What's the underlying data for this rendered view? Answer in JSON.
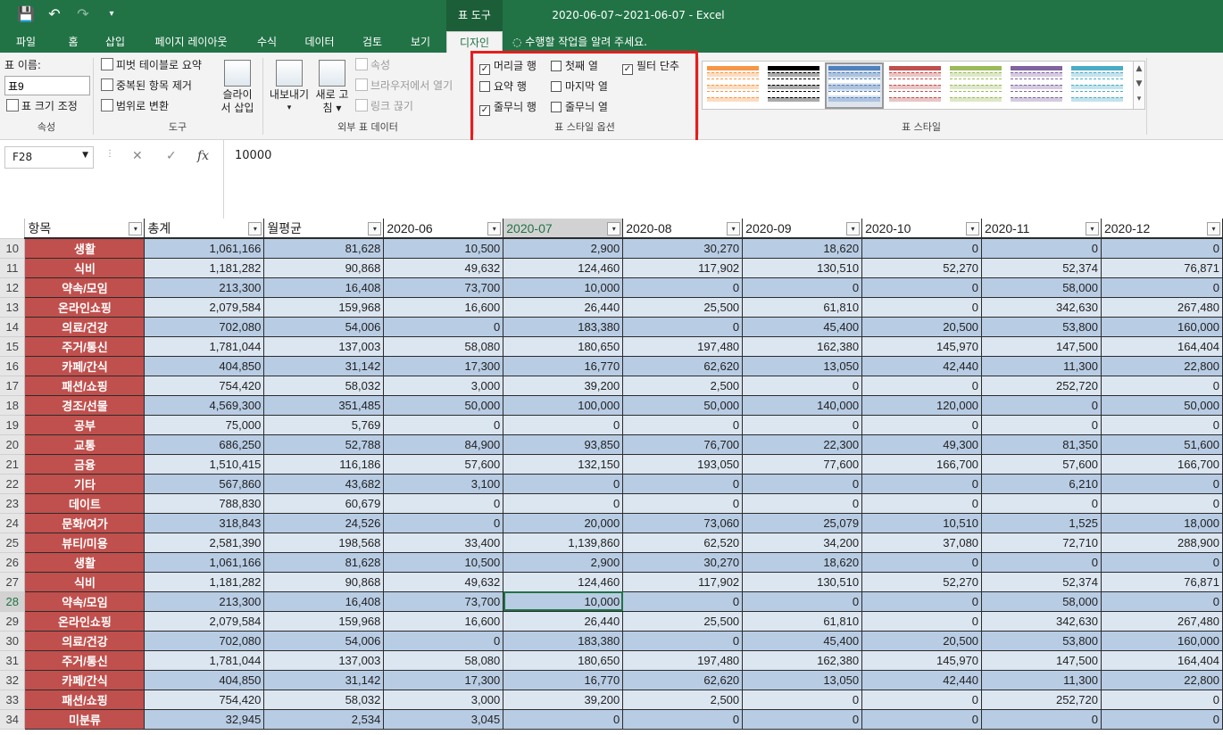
{
  "window": {
    "title": "2020-06-07~2021-06-07 - Excel",
    "context_label": "표 도구"
  },
  "qat": {
    "save": "💾",
    "undo": "↶",
    "redo": "↷",
    "more": "▾"
  },
  "tabs": [
    {
      "label": "파일"
    },
    {
      "label": "홈"
    },
    {
      "label": "삽입"
    },
    {
      "label": "페이지 레이아웃"
    },
    {
      "label": "수식"
    },
    {
      "label": "데이터"
    },
    {
      "label": "검토"
    },
    {
      "label": "보기"
    },
    {
      "label": "디자인"
    }
  ],
  "tell_me": "수행할 작업을 알려 주세요.",
  "ribbon": {
    "props": {
      "name_label": "표 이름:",
      "name_value": "표9",
      "resize": "표 크기 조정",
      "group": "속성"
    },
    "tools": {
      "pivot": "피벗 테이블로 요약",
      "dedupe": "중복된 항목 제거",
      "convert": "범위로 변환",
      "slicer_1": "슬라이",
      "slicer_2": "서 삽입",
      "group": "도구"
    },
    "external": {
      "export_1": "내보내기",
      "export_arrow": "▾",
      "refresh_1": "새로 고",
      "refresh_2": "침 ▾",
      "props": "속성",
      "open_browser": "브라우저에서 열기",
      "unlink": "링크 끊기",
      "group": "외부 표 데이터"
    },
    "options": {
      "header_row": "머리글 행",
      "first_col": "첫째 열",
      "filter_btn": "필터 단추",
      "total_row": "요약 행",
      "last_col": "마지막 열",
      "banded_rows": "줄무늬 행",
      "banded_cols": "줄무늬 열",
      "group": "표 스타일 옵션",
      "checks": {
        "header_row": true,
        "first_col": false,
        "filter_btn": true,
        "total_row": false,
        "last_col": false,
        "banded_rows": true,
        "banded_cols": false
      }
    },
    "styles": {
      "group": "표 스타일",
      "colors": [
        "#f79646",
        "#000000",
        "#4f81bd",
        "#c0504d",
        "#9bbb59",
        "#8064a2",
        "#4bacc6"
      ]
    }
  },
  "formula": {
    "cell": "F28",
    "value": "10000",
    "cancel": "✕",
    "enter": "✓",
    "fx": "fx"
  },
  "sheet": {
    "headers": [
      "항목",
      "총계",
      "월평균",
      "2020-06",
      "2020-07",
      "2020-08",
      "2020-09",
      "2020-10",
      "2020-11",
      "2020-12"
    ],
    "rows": [
      {
        "n": "10",
        "c": [
          "생활",
          "1,061,166",
          "81,628",
          "10,500",
          "2,900",
          "30,270",
          "18,620",
          "0",
          "0",
          "0"
        ]
      },
      {
        "n": "11",
        "c": [
          "식비",
          "1,181,282",
          "90,868",
          "49,632",
          "124,460",
          "117,902",
          "130,510",
          "52,270",
          "52,374",
          "76,871"
        ]
      },
      {
        "n": "12",
        "c": [
          "약속/모임",
          "213,300",
          "16,408",
          "73,700",
          "10,000",
          "0",
          "0",
          "0",
          "58,000",
          "0"
        ]
      },
      {
        "n": "13",
        "c": [
          "온라인쇼핑",
          "2,079,584",
          "159,968",
          "16,600",
          "26,440",
          "25,500",
          "61,810",
          "0",
          "342,630",
          "267,480"
        ]
      },
      {
        "n": "14",
        "c": [
          "의료/건강",
          "702,080",
          "54,006",
          "0",
          "183,380",
          "0",
          "45,400",
          "20,500",
          "53,800",
          "160,000"
        ]
      },
      {
        "n": "15",
        "c": [
          "주거/통신",
          "1,781,044",
          "137,003",
          "58,080",
          "180,650",
          "197,480",
          "162,380",
          "145,970",
          "147,500",
          "164,404"
        ]
      },
      {
        "n": "16",
        "c": [
          "카페/간식",
          "404,850",
          "31,142",
          "17,300",
          "16,770",
          "62,620",
          "13,050",
          "42,440",
          "11,300",
          "22,800"
        ]
      },
      {
        "n": "17",
        "c": [
          "패션/쇼핑",
          "754,420",
          "58,032",
          "3,000",
          "39,200",
          "2,500",
          "0",
          "0",
          "252,720",
          "0"
        ]
      },
      {
        "n": "18",
        "c": [
          "경조/선물",
          "4,569,300",
          "351,485",
          "50,000",
          "100,000",
          "50,000",
          "140,000",
          "120,000",
          "0",
          "50,000"
        ]
      },
      {
        "n": "19",
        "c": [
          "공부",
          "75,000",
          "5,769",
          "0",
          "0",
          "0",
          "0",
          "0",
          "0",
          "0"
        ]
      },
      {
        "n": "20",
        "c": [
          "교통",
          "686,250",
          "52,788",
          "84,900",
          "93,850",
          "76,700",
          "22,300",
          "49,300",
          "81,350",
          "51,600"
        ]
      },
      {
        "n": "21",
        "c": [
          "금융",
          "1,510,415",
          "116,186",
          "57,600",
          "132,150",
          "193,050",
          "77,600",
          "166,700",
          "57,600",
          "166,700"
        ]
      },
      {
        "n": "22",
        "c": [
          "기타",
          "567,860",
          "43,682",
          "3,100",
          "0",
          "0",
          "0",
          "0",
          "6,210",
          "0"
        ]
      },
      {
        "n": "23",
        "c": [
          "데이트",
          "788,830",
          "60,679",
          "0",
          "0",
          "0",
          "0",
          "0",
          "0",
          "0"
        ]
      },
      {
        "n": "24",
        "c": [
          "문화/여가",
          "318,843",
          "24,526",
          "0",
          "20,000",
          "73,060",
          "25,079",
          "10,510",
          "1,525",
          "18,000"
        ]
      },
      {
        "n": "25",
        "c": [
          "뷰티/미용",
          "2,581,390",
          "198,568",
          "33,400",
          "1,139,860",
          "62,520",
          "34,200",
          "37,080",
          "72,710",
          "288,900"
        ]
      },
      {
        "n": "26",
        "c": [
          "생활",
          "1,061,166",
          "81,628",
          "10,500",
          "2,900",
          "30,270",
          "18,620",
          "0",
          "0",
          "0"
        ]
      },
      {
        "n": "27",
        "c": [
          "식비",
          "1,181,282",
          "90,868",
          "49,632",
          "124,460",
          "117,902",
          "130,510",
          "52,270",
          "52,374",
          "76,871"
        ]
      },
      {
        "n": "28",
        "c": [
          "약속/모임",
          "213,300",
          "16,408",
          "73,700",
          "10,000",
          "0",
          "0",
          "0",
          "58,000",
          "0"
        ]
      },
      {
        "n": "29",
        "c": [
          "온라인쇼핑",
          "2,079,584",
          "159,968",
          "16,600",
          "26,440",
          "25,500",
          "61,810",
          "0",
          "342,630",
          "267,480"
        ]
      },
      {
        "n": "30",
        "c": [
          "의료/건강",
          "702,080",
          "54,006",
          "0",
          "183,380",
          "0",
          "45,400",
          "20,500",
          "53,800",
          "160,000"
        ]
      },
      {
        "n": "31",
        "c": [
          "주거/통신",
          "1,781,044",
          "137,003",
          "58,080",
          "180,650",
          "197,480",
          "162,380",
          "145,970",
          "147,500",
          "164,404"
        ]
      },
      {
        "n": "32",
        "c": [
          "카페/간식",
          "404,850",
          "31,142",
          "17,300",
          "16,770",
          "62,620",
          "13,050",
          "42,440",
          "11,300",
          "22,800"
        ]
      },
      {
        "n": "33",
        "c": [
          "패션/쇼핑",
          "754,420",
          "58,032",
          "3,000",
          "39,200",
          "2,500",
          "0",
          "0",
          "252,720",
          "0"
        ]
      },
      {
        "n": "34",
        "c": [
          "미분류",
          "32,945",
          "2,534",
          "3,045",
          "0",
          "0",
          "0",
          "0",
          "0",
          "0"
        ]
      }
    ],
    "selected_row": "28",
    "selected_col_index": 4,
    "filter_arrow": "▾"
  }
}
